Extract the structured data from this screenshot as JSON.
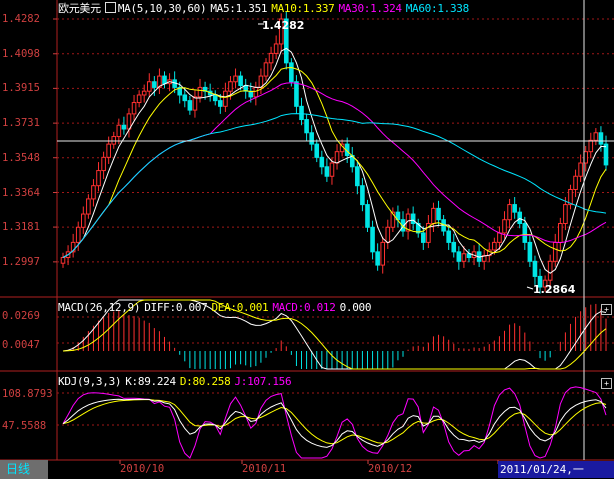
{
  "price_panel": {
    "symbol": "欧元美元",
    "ma_label": "MA(5,10,30,60)",
    "ma5": "MA5:1.351",
    "ma10": "MA10:1.337",
    "ma30": "MA30:1.324",
    "ma60": "MA60:1.338",
    "high_label": "1.4282",
    "low_label": "1.2864",
    "colors": {
      "ma5": "#ffffff",
      "ma10": "#ffff00",
      "ma30": "#ff00ff",
      "ma60": "#00e5ff",
      "up": "#ff3030",
      "down": "#00e5e5",
      "axis": "#d04040"
    }
  },
  "macd_panel": {
    "label": "MACD(26,12,9)",
    "diff": "DIFF:0.007",
    "dea": "DEA:0.001",
    "macd": "MACD:0.012",
    "zero": "0.000"
  },
  "kdj_panel": {
    "label": "KDJ(9,3,3)",
    "k": "K:89.224",
    "d": "D:80.258",
    "j": "J:107.156"
  },
  "bottom_bar": {
    "period": "日线",
    "cursor_date": "2011/01/24,一",
    "x_labels": [
      "2010/10",
      "2010/11",
      "2010/12"
    ]
  },
  "chart_data": {
    "type": "candlestick",
    "price_ticks": [
      "1.4282",
      "1.4098",
      "1.3915",
      "1.3731",
      "1.3548",
      "1.3364",
      "1.3181",
      "1.2997"
    ],
    "macd_ticks": [
      "0.0269",
      "0.0047"
    ],
    "kdj_ticks": [
      "108.8793",
      "47.5588"
    ],
    "close_series": [
      1.302,
      1.305,
      1.31,
      1.318,
      1.325,
      1.333,
      1.34,
      1.348,
      1.355,
      1.362,
      1.366,
      1.372,
      1.37,
      1.378,
      1.384,
      1.388,
      1.39,
      1.395,
      1.392,
      1.398,
      1.394,
      1.396,
      1.392,
      1.388,
      1.385,
      1.38,
      1.387,
      1.392,
      1.39,
      1.388,
      1.385,
      1.382,
      1.39,
      1.395,
      1.398,
      1.393,
      1.39,
      1.387,
      1.392,
      1.398,
      1.405,
      1.41,
      1.415,
      1.4282,
      1.405,
      1.395,
      1.382,
      1.375,
      1.368,
      1.362,
      1.355,
      1.35,
      1.345,
      1.352,
      1.358,
      1.362,
      1.356,
      1.35,
      1.34,
      1.33,
      1.318,
      1.305,
      1.298,
      1.31,
      1.318,
      1.326,
      1.322,
      1.316,
      1.325,
      1.32,
      1.315,
      1.31,
      1.32,
      1.328,
      1.322,
      1.316,
      1.31,
      1.305,
      1.3,
      1.304,
      1.302,
      1.305,
      1.3,
      1.303,
      1.306,
      1.31,
      1.315,
      1.322,
      1.33,
      1.326,
      1.32,
      1.31,
      1.3,
      1.292,
      1.2864,
      1.29,
      1.3,
      1.31,
      1.32,
      1.33,
      1.338,
      1.345,
      1.352,
      1.358,
      1.364,
      1.368,
      1.362,
      1.351
    ]
  }
}
